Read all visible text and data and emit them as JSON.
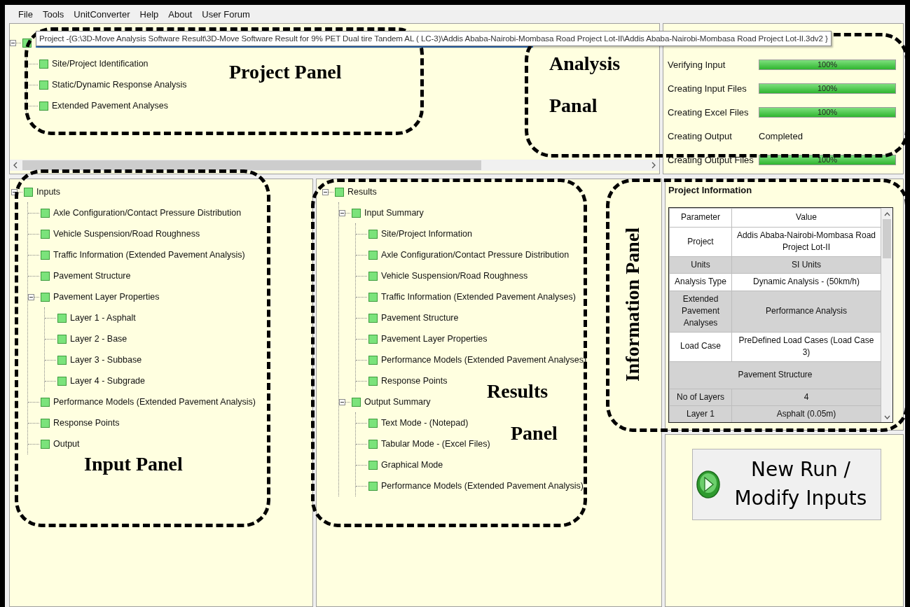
{
  "menu": [
    "File",
    "Tools",
    "UnitConverter",
    "Help",
    "About",
    "User Forum"
  ],
  "project_tooltip": "Project -{G:\\3D-Move Analysis Software Result\\3D-Move Software Result for 9% PET Dual tire Tandem AL ( LC-3)\\Addis Ababa-Nairobi-Mombasa Road Project Lot-II\\Addis Ababa-Nairobi-Mombasa Road Project Lot-II.3dv2 }",
  "project_tree": [
    {
      "expanded": true,
      "children": [
        {
          "label": "Site/Project Identification"
        },
        {
          "label": "Static/Dynamic Response Analysis"
        },
        {
          "label": "Extended Pavement Analyses"
        }
      ]
    }
  ],
  "analysis": [
    {
      "kind": "bar",
      "label": "Verifying Input",
      "level": 1,
      "reading": "100%"
    },
    {
      "kind": "bar",
      "label": "Creating Input Files",
      "level": 1,
      "reading": "100%"
    },
    {
      "kind": "bar",
      "label": "Creating Excel Files",
      "level": 1,
      "reading": "100%"
    },
    {
      "kind": "status",
      "label": "Creating Output",
      "status": "Completed"
    },
    {
      "kind": "bar",
      "label": "Creating Output Files",
      "level": 1,
      "reading": "100%"
    }
  ],
  "input_tree": [
    {
      "label": "Inputs",
      "expanded": true,
      "children": [
        {
          "label": "Axle Configuration/Contact Pressure Distribution"
        },
        {
          "label": "Vehicle  Suspension/Road Roughness"
        },
        {
          "label": "Traffic Information (Extended Pavement Analysis)"
        },
        {
          "label": "Pavement Structure"
        },
        {
          "label": "Pavement Layer Properties",
          "expanded": true,
          "children": [
            {
              "label": "Layer 1 - Asphalt"
            },
            {
              "label": "Layer 2 - Base"
            },
            {
              "label": "Layer 3 - Subbase"
            },
            {
              "label": "Layer 4 - Subgrade"
            }
          ]
        },
        {
          "label": "Performance Models (Extended Pavement Analysis)"
        },
        {
          "label": "Response Points"
        },
        {
          "label": "Output"
        }
      ]
    }
  ],
  "results_tree": [
    {
      "label": "Results",
      "expanded": true,
      "children": [
        {
          "label": "Input Summary",
          "expanded": true,
          "children": [
            {
              "label": "Site/Project Information"
            },
            {
              "label": "Axle Configuration/Contact Pressure Distribution"
            },
            {
              "label": "Vehicle Suspension/Road Roughness"
            },
            {
              "label": "Traffic Information (Extended Pavement Analyses)"
            },
            {
              "label": "Pavement Structure"
            },
            {
              "label": "Pavement Layer Properties"
            },
            {
              "label": "Performance Models (Extended Pavement Analyses)"
            },
            {
              "label": "Response Points"
            }
          ]
        },
        {
          "label": "Output Summary",
          "expanded": true,
          "children": [
            {
              "label": "Text Mode - (Notepad)"
            },
            {
              "label": "Tabular Mode - (Excel Files)"
            },
            {
              "label": "Graphical Mode"
            },
            {
              "label": "Performance Models (Extended Pavement Analysis)"
            }
          ]
        }
      ]
    }
  ],
  "project_information": {
    "title": "Project Information",
    "columns": [
      "Parameter",
      "Value"
    ],
    "rows": [
      {
        "kind": "pair",
        "shaded": false,
        "parameter": "Project",
        "value": "Addis Ababa-Nairobi-Mombasa Road Project Lot-II"
      },
      {
        "kind": "pair",
        "shaded": true,
        "parameter": "Units",
        "value": "SI Units"
      },
      {
        "kind": "pair",
        "shaded": false,
        "parameter": "Analysis Type",
        "value": "Dynamic Analysis - (50km/h)"
      },
      {
        "kind": "pair",
        "shaded": true,
        "parameter": "Extended Pavement Analyses",
        "value": "Performance Analysis"
      },
      {
        "kind": "pair",
        "shaded": false,
        "parameter": "Load Case",
        "value": "PreDefined Load Cases (Load Case 3)"
      },
      {
        "kind": "section",
        "shaded": true,
        "label": "Pavement Structure"
      },
      {
        "kind": "pair",
        "shaded": true,
        "parameter": "No of Layers",
        "value": "4"
      },
      {
        "kind": "pair",
        "shaded": true,
        "parameter": "Layer 1",
        "value": "Asphalt (0.05m)"
      }
    ]
  },
  "run_button": "New Run / Modify Inputs",
  "annotations": [
    {
      "kind": "horizontal",
      "lines": [
        "Project Panel"
      ]
    },
    {
      "kind": "horizontal",
      "lines": [
        "Analysis",
        "Panal"
      ]
    },
    {
      "kind": "horizontal",
      "lines": [
        "Input Panel"
      ]
    },
    {
      "kind": "horizontal",
      "lines": [
        "Results",
        "Panel"
      ]
    },
    {
      "kind": "vertical",
      "lines": [
        "Information Panel"
      ]
    }
  ]
}
